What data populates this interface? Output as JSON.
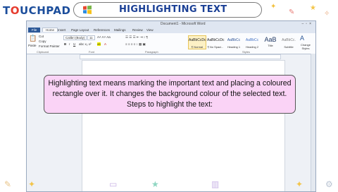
{
  "brand": {
    "logo_text_1": "T",
    "logo_text_2": "O",
    "logo_text_3": "UCHPAD"
  },
  "header": {
    "title": "HIGHLIGHTING TEXT"
  },
  "word": {
    "window_title": "Document1 - Microsoft Word",
    "tabs": [
      "File",
      "Home",
      "Insert",
      "Page Layout",
      "References",
      "Mailings",
      "Review",
      "View"
    ],
    "clipboard": {
      "paste": "Paste",
      "cut": "Cut",
      "copy": "Copy",
      "format_painter": "Format Painter",
      "label": "Clipboard"
    },
    "font": {
      "name": "Calibri (Body)",
      "size": "11",
      "label": "Font"
    },
    "paragraph_label": "Paragraph",
    "styles_label": "Styles",
    "styles": [
      {
        "sample": "AaBbCcDc",
        "name": "¶ Normal"
      },
      {
        "sample": "AaBbCcDc",
        "name": "¶ No Spaci..."
      },
      {
        "sample": "AaBbCc",
        "name": "Heading 1"
      },
      {
        "sample": "AaBbCc",
        "name": "Heading 2"
      },
      {
        "sample": "AaB",
        "name": "Title"
      },
      {
        "sample": "AaBbCc.",
        "name": "Subtitle"
      }
    ],
    "change_styles": "Change Styles"
  },
  "callout": {
    "line1": "Highlighting text means marking the important text and placing a coloured",
    "line2": "rectangle over it. It changes the background colour of the selected text.",
    "line3": "Steps to highlight the text:"
  }
}
